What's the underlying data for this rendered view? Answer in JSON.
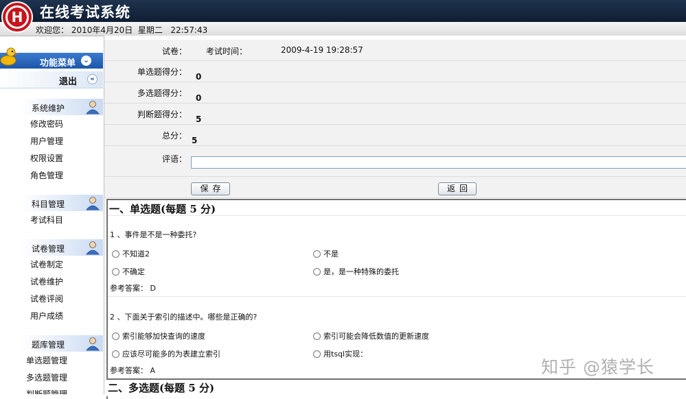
{
  "header": {
    "logo_letter": "H",
    "title": "在线考试系统",
    "welcome": "欢迎您： 2010年4月20日  星期二   22:57:43"
  },
  "sidebar": {
    "menu_title": "功能菜单",
    "exit_label": "退出",
    "groups": [
      {
        "label": "系统维护",
        "items": [
          "修改密码",
          "用户管理",
          "权限设置",
          "角色管理"
        ]
      },
      {
        "label": "科目管理",
        "items": [
          "考试科目"
        ]
      },
      {
        "label": "试卷管理",
        "items": [
          "试卷制定",
          "试卷维护",
          "试卷评阅",
          "用户成绩"
        ]
      },
      {
        "label": "题库管理",
        "items": [
          "单选题管理",
          "多选题管理",
          "判断题管理"
        ]
      }
    ]
  },
  "form": {
    "paper_label": "试卷：",
    "exam_time_label": "考试时间：",
    "exam_time_value": "2009-4-19 19:28:57",
    "single_label": "单选题得分：",
    "single_value": "0",
    "multi_label": "多选题得分：",
    "multi_value": "0",
    "judge_label": "判断题得分：",
    "judge_value": "5",
    "total_label": "总分：",
    "total_value": "5",
    "comment_label": "评语：",
    "comment_value": "",
    "save_label": "保存",
    "back_label": "返回"
  },
  "questions": {
    "section1_title": "一、单选题(每题 5 分)",
    "q1": {
      "text": "1 、事件是不是一种委托?",
      "options": [
        "不知道2",
        "不是",
        "不确定",
        "是，是一种特殊的委托"
      ],
      "answer": "参考答案： D"
    },
    "q2": {
      "text": "2 、下面关于索引的描述中。哪些是正确的?",
      "options": [
        "索引能够加快查询的速度",
        "索引可能会降低数值的更新速度",
        "应该尽可能多的为表建立索引",
        "用tsql实现："
      ],
      "answer": "参考答案： A"
    },
    "section2_title": "二、多选题(每题 5 分)"
  },
  "watermark": "知乎 @猿学长"
}
